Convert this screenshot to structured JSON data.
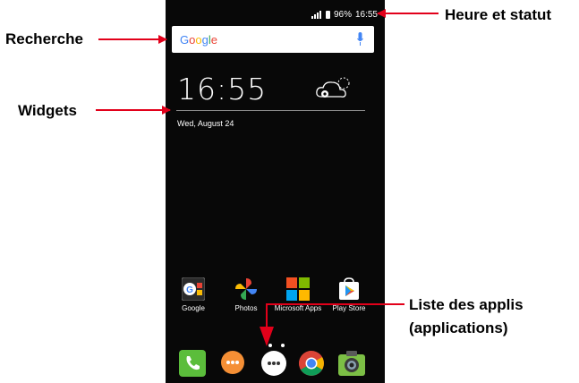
{
  "status_bar": {
    "battery": "96%",
    "time": "16:55"
  },
  "search": {
    "logo_text": "Google"
  },
  "widget": {
    "time": "16:55",
    "date": "Wed, August 24"
  },
  "apps": [
    {
      "label": "Google",
      "icon": "google-folder-icon"
    },
    {
      "label": "Photos",
      "icon": "photos-icon"
    },
    {
      "label": "Microsoft Apps",
      "icon": "microsoft-apps-icon"
    },
    {
      "label": "Play Store",
      "icon": "play-store-icon"
    }
  ],
  "dock": [
    "phone-icon",
    "messages-icon",
    "app-drawer-icon",
    "chrome-icon",
    "camera-icon"
  ],
  "callouts": {
    "status": "Heure et statut",
    "search": "Recherche",
    "widgets": "Widgets",
    "apps_line1": "Liste des applis",
    "apps_line2": "(applications)"
  },
  "colors": {
    "arrow": "#e2001a",
    "screen": "#080808"
  }
}
